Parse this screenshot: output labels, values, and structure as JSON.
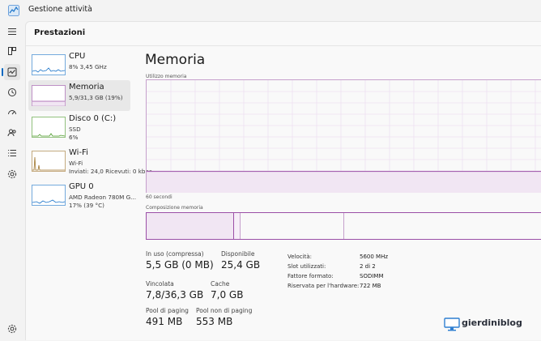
{
  "app": {
    "title": "Gestione attività",
    "icon": "chart-app-icon"
  },
  "header": {
    "title": "Prestazioni"
  },
  "rail": [
    {
      "icon": "hamburger-menu-icon"
    },
    {
      "icon": "processes-icon"
    },
    {
      "icon": "performance-icon",
      "active": true
    },
    {
      "icon": "history-icon"
    },
    {
      "icon": "startup-icon"
    },
    {
      "icon": "users-icon"
    },
    {
      "icon": "details-icon"
    },
    {
      "icon": "services-icon"
    }
  ],
  "sidebar": {
    "items": [
      {
        "name": "CPU",
        "line1": "8%  3,45 GHz",
        "line2": "",
        "color": "#1a73c9"
      },
      {
        "name": "Memoria",
        "line1": "5,9/31,3 GB (19%)",
        "line2": "",
        "color": "#9b4fa7",
        "active": true
      },
      {
        "name": "Disco 0 (C:)",
        "line1": "SSD",
        "line2": "6%",
        "color": "#4c9a2a"
      },
      {
        "name": "Wi-Fi",
        "line1": "Wi-Fi",
        "line2": "Inviati: 24,0  Ricevuti: 0 kbps",
        "color": "#a0762e"
      },
      {
        "name": "GPU 0",
        "line1": "AMD Radeon 780M G...",
        "line2": "17% (39 °C)",
        "color": "#1a73c9"
      }
    ]
  },
  "main": {
    "title": "Memoria",
    "usage_caption": "Utilizzo memoria",
    "time_caption": "60 secondi",
    "composition_caption": "Composizione memoria",
    "usage_fraction": 0.19,
    "stats": {
      "in_use": {
        "label": "In uso (compressa)",
        "value": "5,5 GB (0 MB)"
      },
      "available": {
        "label": "Disponibile",
        "value": "25,4 GB"
      },
      "committed": {
        "label": "Vincolata",
        "value": "7,8/36,3 GB"
      },
      "cached": {
        "label": "Cache",
        "value": "7,0 GB"
      },
      "paged_pool": {
        "label": "Pool di paging",
        "value": "491 MB"
      },
      "nonpaged_pool": {
        "label": "Pool non di paging",
        "value": "553 MB"
      }
    },
    "specs": [
      {
        "label": "Velocità:",
        "value": "5600 MHz"
      },
      {
        "label": "Slot utilizzati:",
        "value": "2 di 2"
      },
      {
        "label": "Fattore formato:",
        "value": "SODIMM"
      },
      {
        "label": "Riservata per l'hardware:",
        "value": "722 MB"
      }
    ]
  },
  "watermark": {
    "text": "gierdiniblog"
  },
  "colors": {
    "memory": "#9b4fa7",
    "memory_fill": "#f1e6f3",
    "accent": "#0067c0"
  }
}
